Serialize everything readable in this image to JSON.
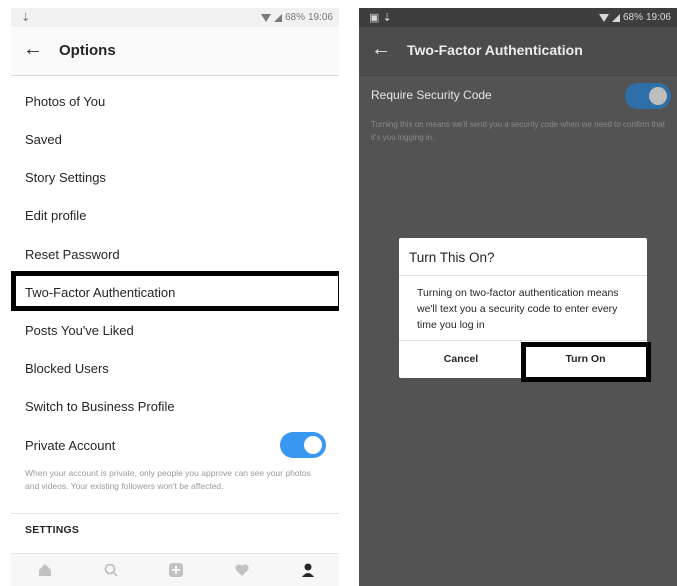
{
  "left": {
    "status": {
      "battery": "68%",
      "time": "19:06"
    },
    "header": {
      "back_icon": "arrow-left-icon",
      "title": "Options"
    },
    "options": [
      "Photos of You",
      "Saved",
      "Story Settings",
      "Edit profile",
      "Reset Password",
      "Two-Factor Authentication",
      "Posts You've Liked",
      "Blocked Users",
      "Switch to Business Profile"
    ],
    "private_account": {
      "label": "Private Account",
      "toggle_on": true,
      "helper": "When your account is private, only people you approve can see your photos and videos. Your existing followers won't be affected."
    },
    "settings_header": "SETTINGS",
    "tabbar_icons": [
      "home-icon",
      "search-icon",
      "add-icon",
      "heart-icon",
      "profile-icon"
    ]
  },
  "right": {
    "status": {
      "battery": "68%",
      "time": "19:06"
    },
    "header": {
      "back_icon": "arrow-left-icon",
      "title": "Two-Factor Authentication"
    },
    "require_code": {
      "label": "Require Security Code",
      "toggle_on": true,
      "description": "Turning this on means we'll send you a security code when we need to confirm that it's you logging in."
    },
    "dialog": {
      "title": "Turn This On?",
      "body": "Turning on two-factor authentication means we'll text you a security code to enter every time you log in",
      "cancel": "Cancel",
      "confirm": "Turn On"
    }
  },
  "colors": {
    "accent": "#3897f0",
    "highlight_border": "#000000"
  }
}
